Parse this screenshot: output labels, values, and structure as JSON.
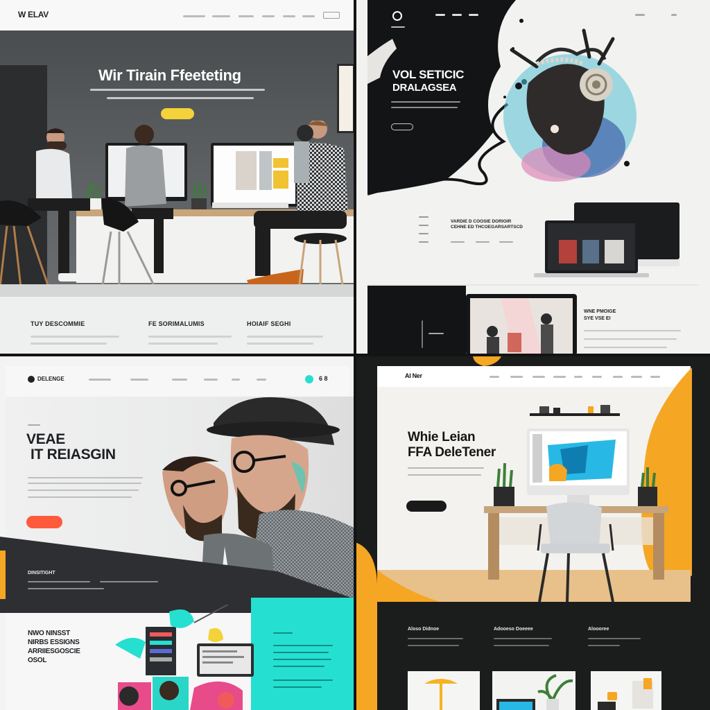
{
  "q1": {
    "logo": "W ELAV",
    "hero_title": "Wir Tirain Ffeeteting",
    "features": [
      "TUY DESCOMMIE",
      "FE SORIMALUMIS",
      "HOIAIF SEGHI"
    ]
  },
  "q2": {
    "hero_title_line1": "VOL SETICIC",
    "hero_title_line2": "DRALAGSEA",
    "section_heading": "VARDIE D COOSIE DORIOIR",
    "section_subheading": "CEHNE ED THCOEGARSARTSCD",
    "side_heading_line1": "WNE PMOIGE",
    "side_heading_line2": "SYE VSE EI"
  },
  "q3": {
    "logo": "DELENGE",
    "hero_title_line1": "VEAE",
    "hero_title_line2": "IT REIASGIN",
    "band_label": "DINSITIGHT",
    "block_title": [
      "NWO NINSST",
      "NIRBS ESSIGNS",
      "ARRIIESGOSCIE",
      "OSOL"
    ],
    "accent": "#ff5a3c",
    "teal": "#25e0d0"
  },
  "q4": {
    "logo": "Al Ner",
    "hero_title_line1": "Whie Leian",
    "hero_title_line2": "FFA DeleTener",
    "features": [
      "Aloso Didnoe",
      "Adooeso Doeeee",
      "Aloooree"
    ],
    "accent": "#f5a623"
  }
}
